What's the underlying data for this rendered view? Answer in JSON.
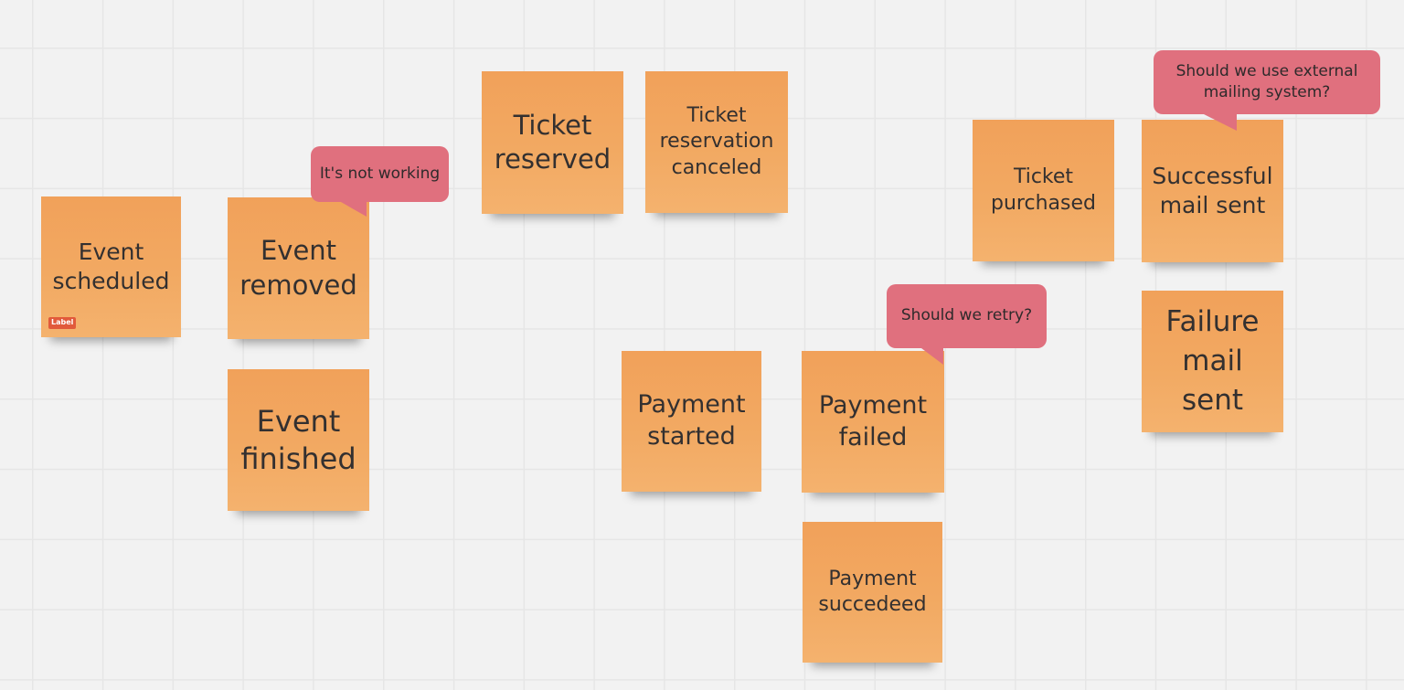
{
  "board": {
    "stickies": [
      {
        "id": "event-scheduled",
        "text": "Event scheduled",
        "tag": "Label"
      },
      {
        "id": "event-removed",
        "text": "Event removed"
      },
      {
        "id": "event-finished",
        "text": "Event finished"
      },
      {
        "id": "ticket-reserved",
        "text": "Ticket reserved"
      },
      {
        "id": "ticket-reservation-canceled",
        "text": "Ticket reservation canceled"
      },
      {
        "id": "payment-started",
        "text": "Payment started"
      },
      {
        "id": "payment-failed",
        "text": "Payment failed"
      },
      {
        "id": "payment-succeeded",
        "text": "Payment succedeed"
      },
      {
        "id": "ticket-purchased",
        "text": "Ticket purchased"
      },
      {
        "id": "successful-mail-sent",
        "text": "Successful mail sent"
      },
      {
        "id": "failure-mail-sent",
        "text": "Failure mail sent"
      }
    ],
    "comments": [
      {
        "id": "not-working",
        "text": "It's not working"
      },
      {
        "id": "retry",
        "text": "Should we retry?"
      },
      {
        "id": "external-mailing",
        "text": "Should we use external mailing system?"
      }
    ],
    "colors": {
      "sticky": "#f2a65e",
      "comment": "#e0707e",
      "tag": "#e15a3b",
      "background": "#f2f2f2"
    }
  }
}
